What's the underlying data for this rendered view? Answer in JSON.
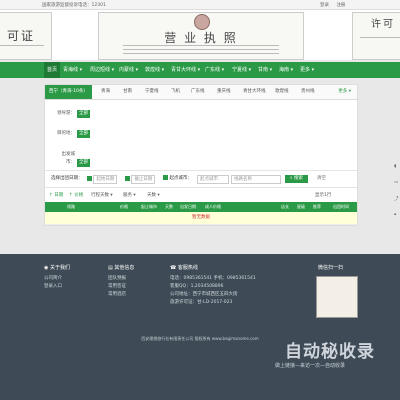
{
  "topbar": {
    "left": "国家旅游监督投诉电话：12301",
    "login": "登录",
    "register": "注册"
  },
  "banner": {
    "cert_left": "可证",
    "cert_center": "营 业 执 照",
    "cert_right": "许可"
  },
  "nav": {
    "items": [
      "首页",
      "青海线 ▾",
      "周边短线 ▾",
      "内蒙线 ▾",
      "敦煌线 ▾",
      "青甘大环线 ▾",
      "广东线 ▾",
      "宁夏线 ▾",
      "甘南 ▾",
      "海南 ▾",
      "更多 ▾"
    ]
  },
  "tabs": {
    "items": [
      "西宁（青海-10条）",
      "青海",
      "甘南",
      "宁夏线",
      "飞机",
      "广东线",
      "重庆线",
      "青甘大环线",
      "敦煌线",
      "贵州线"
    ],
    "more": "更多 ▾"
  },
  "filters": {
    "rows": [
      {
        "label": "领导游：",
        "value": "全部"
      },
      {
        "label": "目的地：",
        "value": "全部"
      },
      {
        "label": "出发城市：",
        "value": "全部"
      }
    ]
  },
  "search": {
    "date_label": "选择出团日期：",
    "start_placeholder": "起始日期",
    "end_placeholder": "截止日期",
    "city_label": "起点城市：",
    "city_placeholder": "起点城市",
    "keyword_placeholder": "线路名称",
    "button": "搜索",
    "reset": "清空"
  },
  "sort": {
    "items": [
      "↑ 日期",
      "↑ 价格",
      "行程天数 ▾",
      "服务 ▾",
      "天数 ▾"
    ],
    "toggle": "显示1行"
  },
  "table": {
    "headers": [
      "线路",
      "价格",
      "起止城市",
      "天数",
      "出发日期",
      "成人价格",
      "店长",
      "星级",
      "推荐",
      "出团时间"
    ],
    "empty_text": "暂无数据"
  },
  "footer": {
    "about": {
      "title": "关于我们",
      "items": [
        "公司简介",
        "登录入口"
      ]
    },
    "info": {
      "title": "其他信息",
      "items": [
        "团队预报",
        "常用签证",
        "常用酒店"
      ]
    },
    "contact": {
      "title": "客服热线",
      "lines": [
        "电话：0985361541 手机：0985361541",
        "客服QQ：1,2034508896",
        "公司地址：西宁市城西区五四大街",
        "旅游许可证：甘-LD-2017-023"
      ]
    },
    "qr": {
      "title": "微信扫一扫"
    },
    "copyright": "西安理想旅行社有限责任公司 版权所有 www.bagimanome.com"
  },
  "watermark": {
    "big": "自动秘收录",
    "small": "做上链接—来访一次—自动收录"
  }
}
